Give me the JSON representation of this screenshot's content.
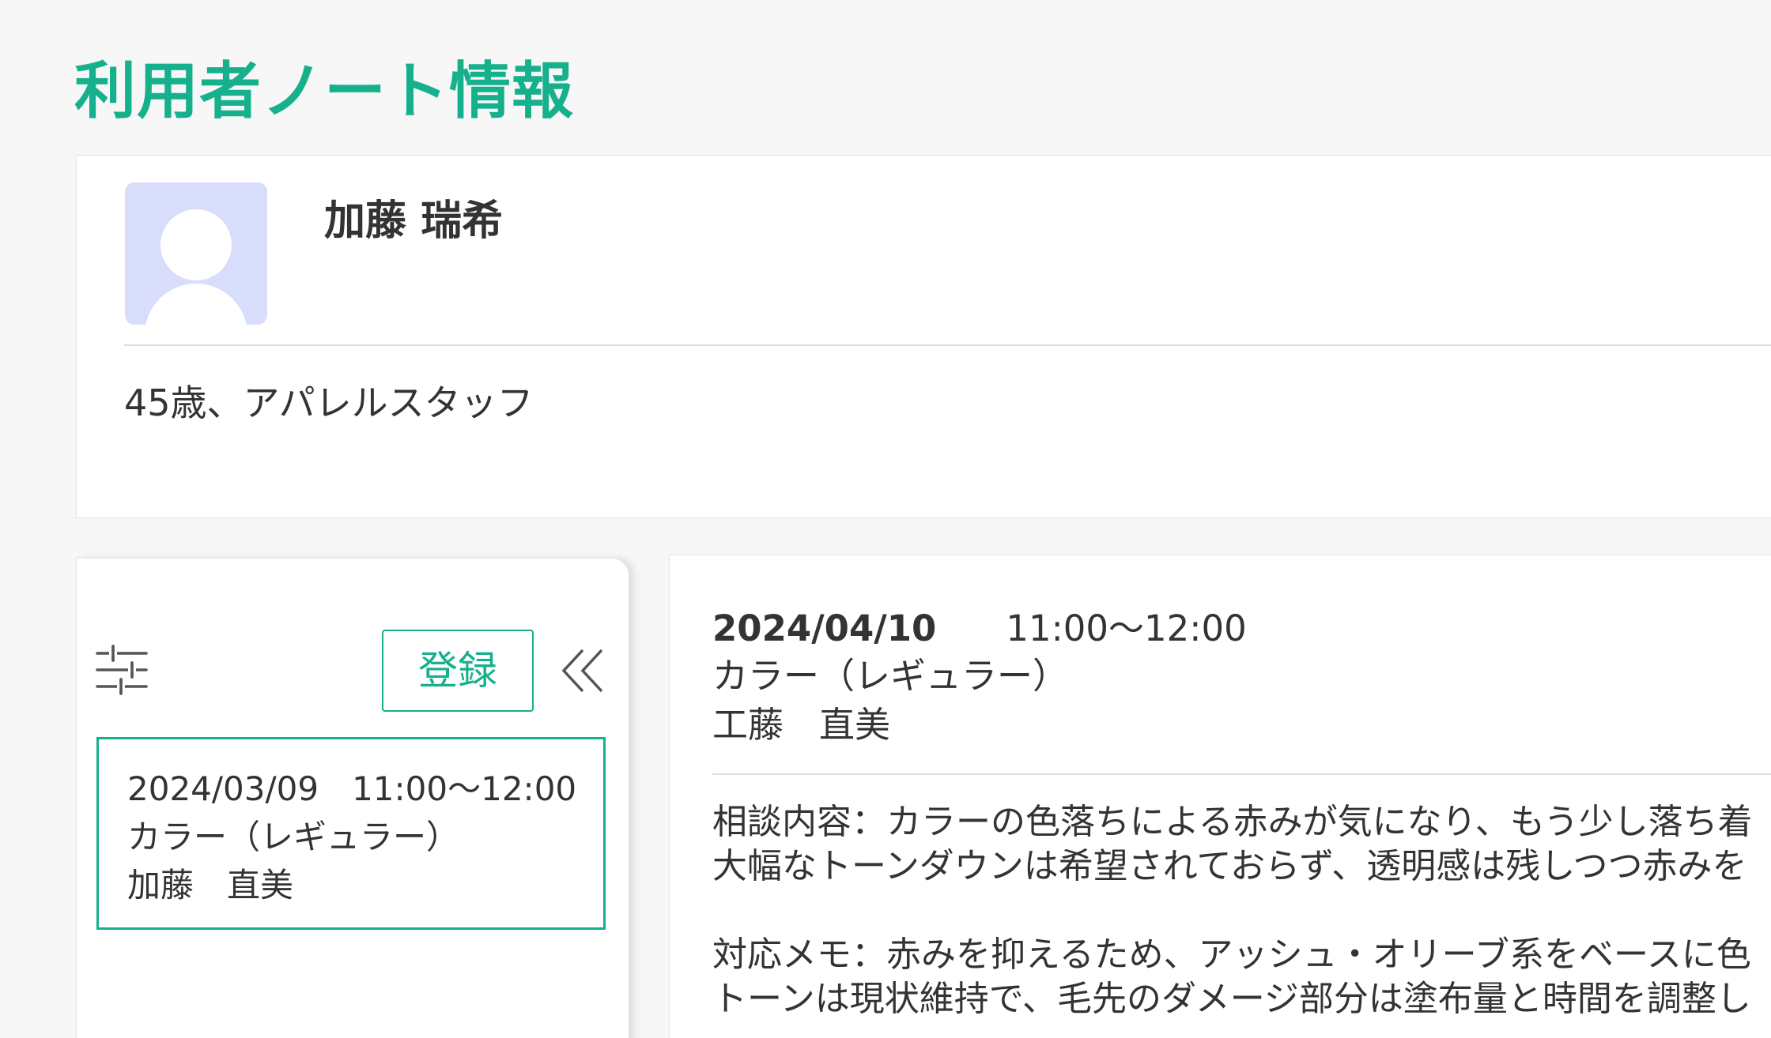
{
  "page": {
    "title": "利用者ノート情報"
  },
  "profile": {
    "name": "加藤 瑞希",
    "description": "45歳、アパレルスタッフ",
    "avatar_icon": "user-avatar-icon",
    "avatar_color": "#d7ddfb"
  },
  "list_panel": {
    "filter_icon": "sliders-icon",
    "register_label": "登録",
    "collapse_icon": "double-chevron-left-icon",
    "records": [
      {
        "datetime": "2024/03/09　11:00〜12:00",
        "menu": "カラー（レギュラー）",
        "staff": "加藤　直美"
      }
    ]
  },
  "detail": {
    "date": "2024/04/10",
    "time": "11:00〜12:00",
    "menu": "カラー（レギュラー）",
    "staff": "工藤　直美",
    "consultation_line1": "相談内容：カラーの色落ちによる赤みが気になり、もう少し落ち着",
    "consultation_line2": "大幅なトーンダウンは希望されておらず、透明感は残しつつ赤みを",
    "memo_line1": "対応メモ：赤みを抑えるため、アッシュ・オリーブ系をベースに色",
    "memo_line2": "トーンは現状維持で、毛先のダメージ部分は塗布量と時間を調整し"
  },
  "colors": {
    "accent": "#16b08c",
    "background": "#f7f7f7",
    "text": "#333333"
  }
}
